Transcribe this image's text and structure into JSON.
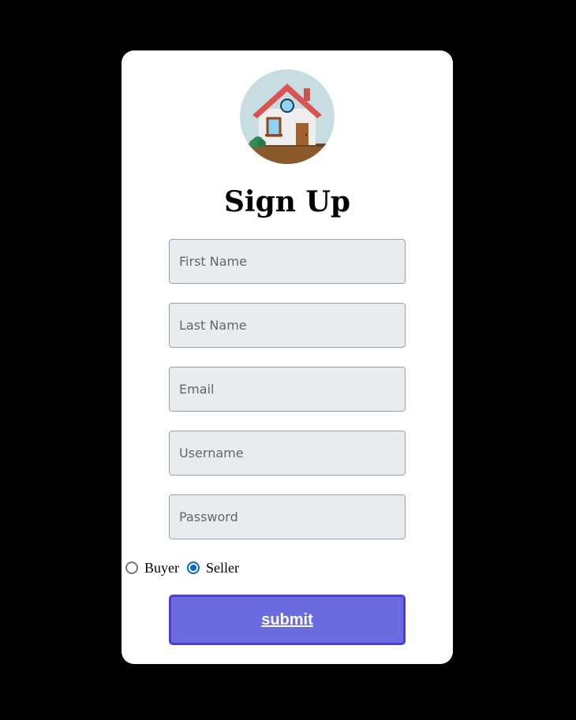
{
  "form": {
    "title": "Sign Up",
    "logo_icon": "house-icon",
    "fields": {
      "first_name": {
        "placeholder": "First Name",
        "value": ""
      },
      "last_name": {
        "placeholder": "Last Name",
        "value": ""
      },
      "email": {
        "placeholder": "Email",
        "value": ""
      },
      "username": {
        "placeholder": "Username",
        "value": ""
      },
      "password": {
        "placeholder": "Password",
        "value": ""
      }
    },
    "roles": {
      "buyer_label": "Buyer",
      "seller_label": "Seller",
      "selected": "Seller"
    },
    "submit_label": "submit"
  },
  "colors": {
    "page_background": "#000000",
    "card_background": "#ffffff",
    "input_background": "#e8ecee",
    "button_background": "#6b6be0",
    "button_border": "#4a3fd0",
    "radio_accent": "#0a66d6"
  }
}
